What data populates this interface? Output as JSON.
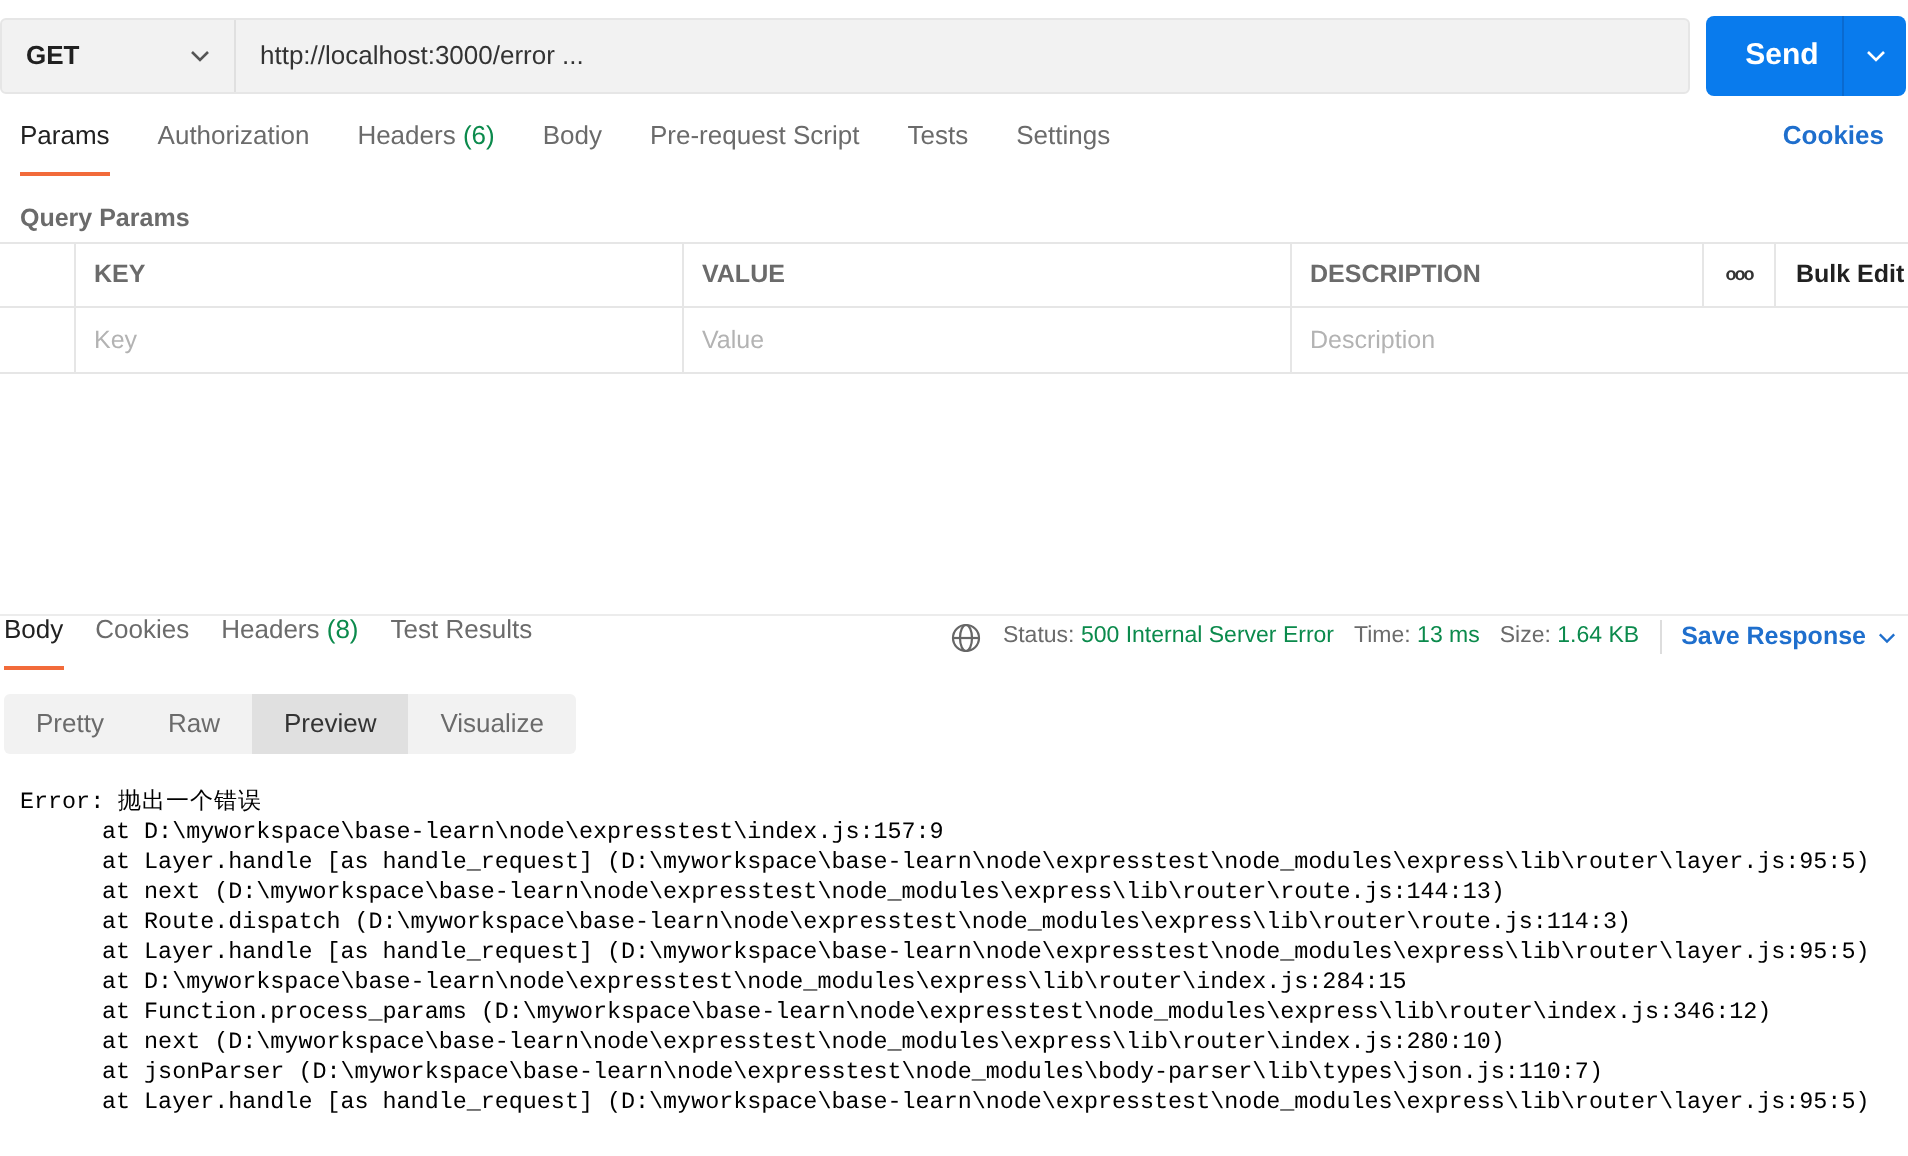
{
  "request": {
    "method": "GET",
    "url": "http://localhost:3000/error ...",
    "send_label": "Send"
  },
  "request_tabs": [
    {
      "label": "Params",
      "selected": true
    },
    {
      "label": "Authorization",
      "selected": false
    },
    {
      "label": "Headers",
      "count": "(6)",
      "selected": false
    },
    {
      "label": "Body",
      "selected": false
    },
    {
      "label": "Pre-request Script",
      "selected": false
    },
    {
      "label": "Tests",
      "selected": false
    },
    {
      "label": "Settings",
      "selected": false
    }
  ],
  "cookies_link": "Cookies",
  "query_params": {
    "title": "Query Params",
    "columns": [
      "KEY",
      "VALUE",
      "DESCRIPTION"
    ],
    "more": "ooo",
    "bulk_edit": "Bulk Edit",
    "placeholders": [
      "Key",
      "Value",
      "Description"
    ]
  },
  "response_tabs": [
    {
      "label": "Body",
      "selected": true
    },
    {
      "label": "Cookies",
      "selected": false
    },
    {
      "label": "Headers",
      "count": "(8)",
      "selected": false
    },
    {
      "label": "Test Results",
      "selected": false
    }
  ],
  "response_meta": {
    "status_label": "Status:",
    "status": "500 Internal Server Error",
    "time_label": "Time:",
    "time": "13 ms",
    "size_label": "Size:",
    "size": "1.64 KB",
    "save": "Save Response"
  },
  "view_modes": [
    {
      "label": "Pretty",
      "selected": false
    },
    {
      "label": "Raw",
      "selected": false
    },
    {
      "label": "Preview",
      "selected": true
    },
    {
      "label": "Visualize",
      "selected": false
    }
  ],
  "preview": {
    "error": "Error: 抛出一个错误",
    "stack": [
      "at D:\\myworkspace\\base-learn\\node\\expresstest\\index.js:157:9",
      "at Layer.handle [as handle_request] (D:\\myworkspace\\base-learn\\node\\expresstest\\node_modules\\express\\lib\\router\\layer.js:95:5)",
      "at next (D:\\myworkspace\\base-learn\\node\\expresstest\\node_modules\\express\\lib\\router\\route.js:144:13)",
      "at Route.dispatch (D:\\myworkspace\\base-learn\\node\\expresstest\\node_modules\\express\\lib\\router\\route.js:114:3)",
      "at Layer.handle [as handle_request] (D:\\myworkspace\\base-learn\\node\\expresstest\\node_modules\\express\\lib\\router\\layer.js:95:5)",
      "at D:\\myworkspace\\base-learn\\node\\expresstest\\node_modules\\express\\lib\\router\\index.js:284:15",
      "at Function.process_params (D:\\myworkspace\\base-learn\\node\\expresstest\\node_modules\\express\\lib\\router\\index.js:346:12)",
      "at next (D:\\myworkspace\\base-learn\\node\\expresstest\\node_modules\\express\\lib\\router\\index.js:280:10)",
      "at jsonParser (D:\\myworkspace\\base-learn\\node\\expresstest\\node_modules\\body-parser\\lib\\types\\json.js:110:7)",
      "at Layer.handle [as handle_request] (D:\\myworkspace\\base-learn\\node\\expresstest\\node_modules\\express\\lib\\router\\layer.js:95:5)"
    ]
  }
}
